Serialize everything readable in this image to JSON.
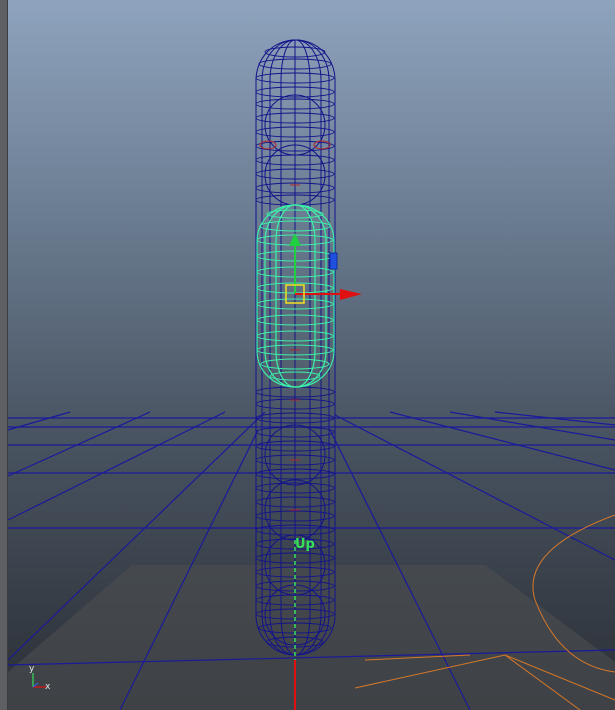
{
  "viewport": {
    "name": "perspective-viewport",
    "up_label": "Up"
  },
  "axis_indicator": {
    "y_label": "y",
    "x_label": "x"
  },
  "colors": {
    "wireframe": "#13138a",
    "selected": "#3cf0a8",
    "grid": "#1a1a9a",
    "ground_plane": "#4e5052",
    "move_x": "#e01010",
    "move_y": "#20d040",
    "move_z": "#2050e0",
    "up_vector": "#35e05a",
    "ellipse": "#d6782a"
  }
}
